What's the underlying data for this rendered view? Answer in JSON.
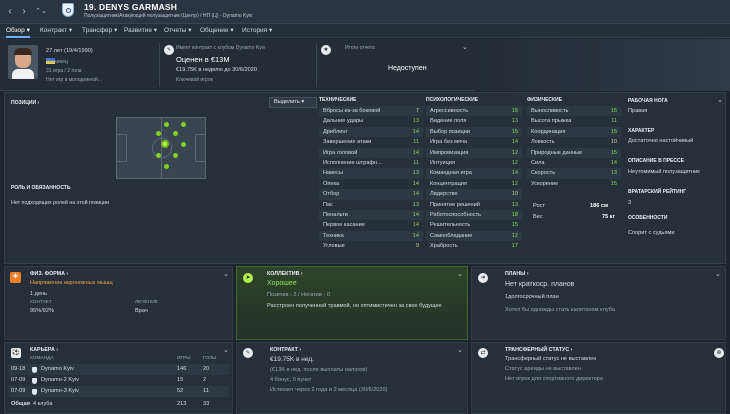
{
  "player": {
    "name": "19. DENYS GARMASH",
    "subtitle": "Полузащитник/Атакующий полузащитник (Центр) / НП (Ц) - Dynamo Kyiv"
  },
  "menu": [
    "Обзор",
    "Контракт",
    "Трансфер",
    "Развитие",
    "Отчеты",
    "Общение",
    "История"
  ],
  "header": {
    "age": "27 лет (19/4/1990)",
    "nationality": "Украинец",
    "caps": "31 игра / 2 гола",
    "injury": "Нет игр в молодежной...",
    "contract_line": "Имеет контракт с клубом Dynamo Kyiv",
    "value": "Оценен в €13M",
    "wage": "€19.75K в неделю до 30/6/2020",
    "role": "Ключевой игрок",
    "report_title": "Итоги отчета",
    "report_status": "Недоступен"
  },
  "positions": {
    "title": "ПОЗИЦИИ",
    "select_label": "Выделить",
    "roles_title": "РОЛЬ И ОБЯЗАННОСТЬ",
    "roles_text": "Нет подходящих ролей на этой позиции"
  },
  "technical": {
    "title": "ТЕХНИЧЕСКИЕ",
    "rows": [
      [
        "Вбросы из-за боковой",
        "7"
      ],
      [
        "Дальние удары",
        "13"
      ],
      [
        "Дриблинг",
        "14"
      ],
      [
        "Завершение атаки",
        "11"
      ],
      [
        "Игра головой",
        "14"
      ],
      [
        "Исполнение штрафн...",
        "11"
      ],
      [
        "Навесы",
        "13"
      ],
      [
        "Опека",
        "14"
      ],
      [
        "Отбор",
        "14"
      ],
      [
        "Пас",
        "13"
      ],
      [
        "Пенальти",
        "14"
      ],
      [
        "Первое касание",
        "14"
      ],
      [
        "Техника",
        "14"
      ],
      [
        "Угловые",
        "9"
      ]
    ]
  },
  "mental": {
    "title": "ПСИХОЛОГИЧЕСКИЕ",
    "rows": [
      [
        "Агрессивность",
        "15"
      ],
      [
        "Видение поля",
        "13"
      ],
      [
        "Выбор позиции",
        "15"
      ],
      [
        "Игра без мяча",
        "14"
      ],
      [
        "Импровизация",
        "12"
      ],
      [
        "Интуиция",
        "12"
      ],
      [
        "Командная игра",
        "14"
      ],
      [
        "Концентрация",
        "12"
      ],
      [
        "Лидерство",
        "10"
      ],
      [
        "Принятие решений",
        "13"
      ],
      [
        "Работоспособность",
        "18"
      ],
      [
        "Решительность",
        "15"
      ],
      [
        "Самообладание",
        "12"
      ],
      [
        "Храбрость",
        "17"
      ]
    ]
  },
  "physical": {
    "title": "ФИЗИЧЕСКИЕ",
    "rows": [
      [
        "Выносливость",
        "15"
      ],
      [
        "Высота прыжка",
        "11"
      ],
      [
        "Координация",
        "15"
      ],
      [
        "Ловкость",
        "10"
      ],
      [
        "Природные данные",
        "15"
      ],
      [
        "Сила",
        "14"
      ],
      [
        "Скорость",
        "13"
      ],
      [
        "Ускорение",
        "15"
      ]
    ],
    "height_label": "Рост",
    "height": "186 см",
    "weight_label": "Вес",
    "weight": "75 кг"
  },
  "side": {
    "foot_title": "РАБОЧАЯ НОГА",
    "foot": "Правая",
    "character_title": "ХАРАКТЕР",
    "character": "Достаточно настойчивый",
    "press_title": "ОПИСАНИЕ В ПРЕССЕ",
    "press": "Неутомимый полузащитник",
    "gk_title": "ВРАТАРСКИЙ РЕЙТИНГ",
    "gk": "3",
    "special_title": "ОСОБЕННОСТИ",
    "special": "Спорит с судьями"
  },
  "fitness": {
    "title": "ФИЗ. ФОРМА",
    "status": "Напряжение икроножных мышц",
    "days": "1 день",
    "contact_label": "КОНТАКТ",
    "contact": "95%/92%",
    "treatment_label": "ЛЕЧЕНИЕ",
    "treatment": "Врач"
  },
  "team": {
    "title": "КОЛЛЕКТИВ",
    "status": "Хорошее",
    "summary": "Позитив - 2 / Негатив - 0",
    "note": "Расстроен полученной травмой, но оптимистичен за свое будущее"
  },
  "plans": {
    "title": "ПЛАНЫ",
    "status": "Нет краткоср. планов",
    "long": "1долгосрочный план",
    "note": "Хотел бы однажды стать капитаном клуба"
  },
  "career": {
    "title": "КАРЬЕРА",
    "cols": [
      "КОМАНДА",
      "ИГРЫ",
      "ГОЛЫ"
    ],
    "rows": [
      [
        "09-18",
        "Dynamo Kyiv",
        "146",
        "20"
      ],
      [
        "07-09",
        "Dynamo-2 Kyiv",
        "15",
        "2"
      ],
      [
        "07-09",
        "Dynamo-3 Kyiv",
        "52",
        "11"
      ]
    ],
    "total": [
      "Общая",
      "4 клуба",
      "213",
      "33"
    ]
  },
  "contract": {
    "title": "КОНТРАКТ",
    "wage": "€19.75K в нед.",
    "tax": "(€13K в нед. после выплаты налогов)",
    "bonus": "4 бонус, 0 пункт",
    "expires": "Истекает через 2 года и 2 месяца (30/6/2020)"
  },
  "transfer": {
    "title": "ТРАНСФЕРНЫЙ СТАТУС",
    "status": "Трансферный статус не выставлен",
    "loan": "Статус аренды не выставлен",
    "director": "Нет игрок для спортивного директора"
  },
  "colors": {
    "accent": "#7ee84b",
    "link": "#6ab0ff"
  }
}
